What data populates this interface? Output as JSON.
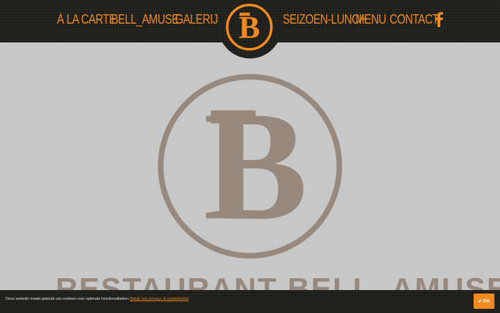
{
  "nav": {
    "left": [
      "À LA CARTE",
      "BELL_AMUSE",
      "GALERIJ"
    ],
    "right": [
      "SEIZOEN-LUNCH",
      "MENU",
      "CONTACT"
    ],
    "facebook_icon": "facebook-icon",
    "logo_letter": "B"
  },
  "hero": {
    "logo_letter": "B",
    "title": "RESTAURANT  BELL_AMUSE"
  },
  "cookie": {
    "text": "Deze website maakt gebruik van cookies voor optimale functionaliteiten.",
    "link": "Bekijk ons privacy- & cookiebeleid",
    "ok_label": "OK",
    "ok_icon": "check-icon"
  },
  "colors": {
    "accent": "#f28a1f",
    "header_bg": "#1e1e1a",
    "hero_bg": "#c7c7c7",
    "logo_taupe": "#97897d"
  }
}
